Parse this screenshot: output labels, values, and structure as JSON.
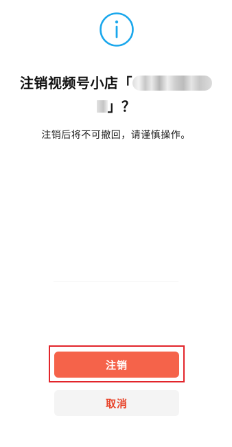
{
  "icon": {
    "name": "info-circle-icon",
    "color": "#1aa7ec"
  },
  "dialog": {
    "title_prefix": "注销视频号小店「",
    "title_suffix": "」？",
    "description": "注销后将不可撤回，请谨慎操作。"
  },
  "actions": {
    "confirm_label": "注销",
    "cancel_label": "取消",
    "confirm_color": "#f5634a",
    "cancel_text_color": "#e8442a",
    "highlight_color": "#e2242a"
  }
}
